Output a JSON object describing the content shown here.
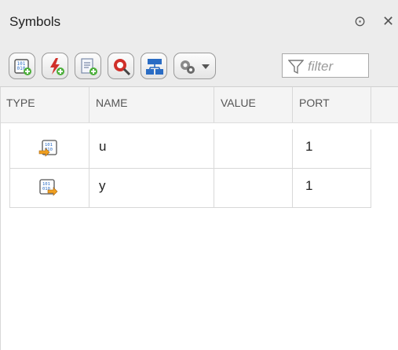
{
  "panel": {
    "title": "Symbols",
    "menu_glyph": "⊙",
    "close_glyph": "✕"
  },
  "toolbar": {
    "buttons": [
      {
        "name": "add-symbol-icon"
      },
      {
        "name": "add-event-icon"
      },
      {
        "name": "add-message-icon"
      },
      {
        "name": "resolve-symbols-icon"
      },
      {
        "name": "hierarchy-icon"
      },
      {
        "name": "settings-icon"
      }
    ],
    "filter_placeholder": "filter"
  },
  "table": {
    "columns": [
      "TYPE",
      "NAME",
      "VALUE",
      "PORT"
    ],
    "rows": [
      {
        "type_icon": "input-data-icon",
        "name": "u",
        "value": "",
        "port": "1"
      },
      {
        "type_icon": "output-data-icon",
        "name": "y",
        "value": "",
        "port": "1"
      }
    ]
  },
  "colors": {
    "accent_blue": "#2a6cc4",
    "accent_green": "#4caf3a",
    "accent_red": "#d0302a",
    "accent_orange": "#f0a020"
  }
}
